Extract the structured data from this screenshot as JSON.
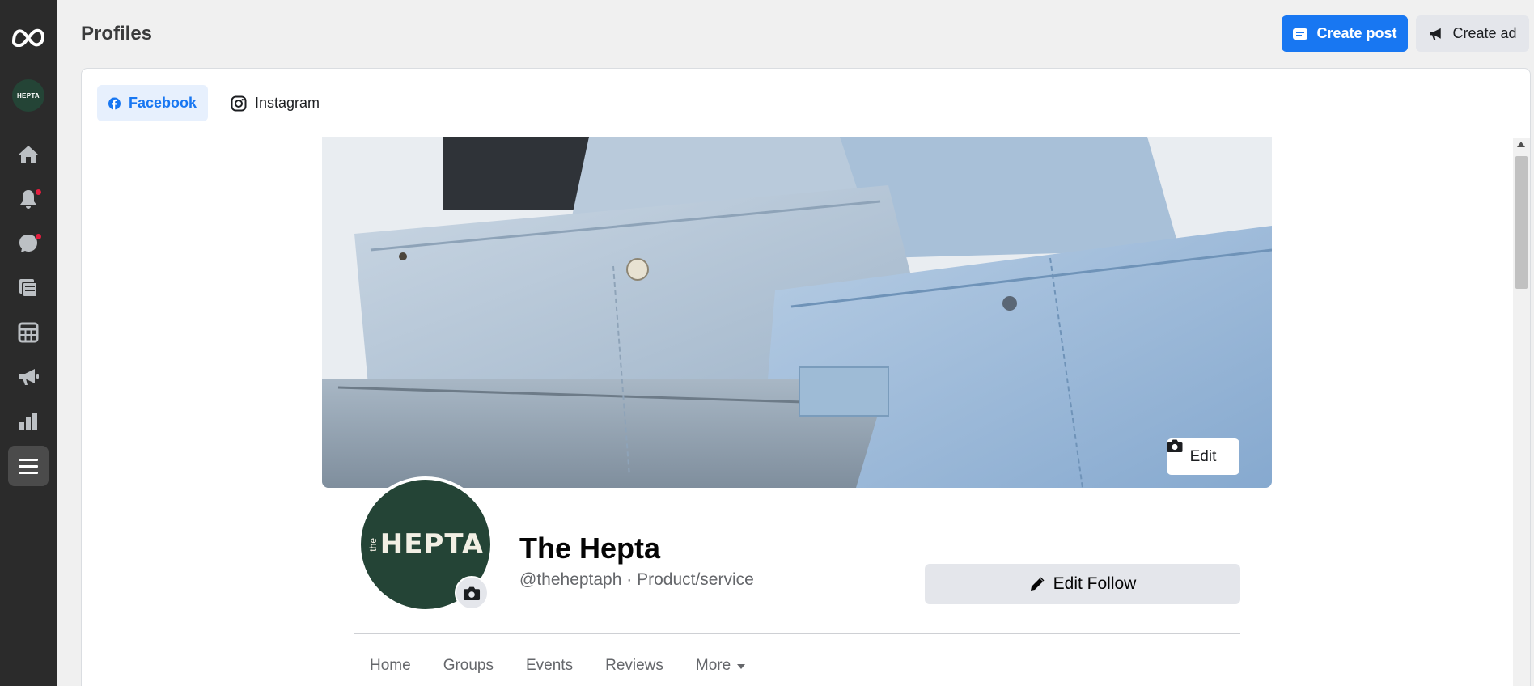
{
  "header": {
    "title": "Profiles",
    "create_post": "Create post",
    "create_ad": "Create ad"
  },
  "sidebar": {
    "avatar_text": "HEPTA",
    "items": [
      {
        "icon": "meta-logo-icon"
      },
      {
        "icon": "home-icon"
      },
      {
        "icon": "bell-icon",
        "badge": true
      },
      {
        "icon": "chat-icon",
        "badge": true
      },
      {
        "icon": "content-icon"
      },
      {
        "icon": "calendar-grid-icon"
      },
      {
        "icon": "megaphone-icon"
      },
      {
        "icon": "insights-icon"
      },
      {
        "icon": "menu-icon",
        "active": true
      }
    ]
  },
  "tabs": [
    {
      "label": "Facebook",
      "selected": true
    },
    {
      "label": "Instagram",
      "selected": false
    }
  ],
  "cover": {
    "edit_label": "Edit"
  },
  "profile": {
    "logo_the": "the",
    "logo_name": "HEPTA",
    "name": "The Hepta",
    "subtitle": "@theheptaph · Product/service",
    "edit_follow": "Edit Follow"
  },
  "nav": [
    "Home",
    "Groups",
    "Events",
    "Reviews",
    "More"
  ],
  "colors": {
    "accent": "#1877f2",
    "rail": "#2b2b2b",
    "brand_green": "#244436",
    "badge": "#e41e3f"
  }
}
